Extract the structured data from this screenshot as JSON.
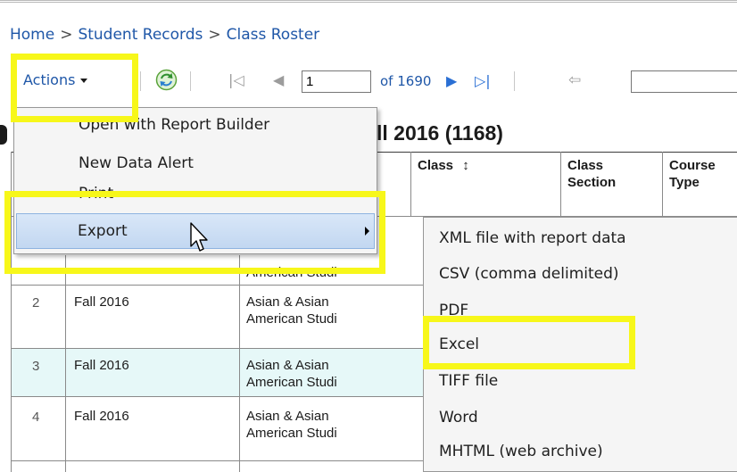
{
  "breadcrumb": {
    "items": [
      "Home",
      "Student Records",
      "Class Roster"
    ],
    "separator": ">"
  },
  "toolbar": {
    "actions_label": "Actions",
    "page_value": "1",
    "page_of": "of 1690"
  },
  "report": {
    "title_visible": "ll 2016 (1168)"
  },
  "table": {
    "headers": {
      "class": "Class",
      "class_sort_glyph": "↕",
      "class_section_1": "Class",
      "class_section_2": "Section",
      "course_type_1": "Course",
      "course_type_2": "Type"
    },
    "row1_partial": "American Studi",
    "rows": [
      {
        "num": "2",
        "term": "Fall 2016",
        "dept_1": "Asian & Asian",
        "dept_2": "American Studi"
      },
      {
        "num": "3",
        "term": "Fall 2016",
        "dept_1": "Asian & Asian",
        "dept_2": "American Studi"
      },
      {
        "num": "4",
        "term": "Fall 2016",
        "dept_1": "Asian & Asian",
        "dept_2": "American Studi"
      }
    ]
  },
  "actions_menu": {
    "items": [
      "Open with Report Builder",
      "New Data Alert",
      "Print",
      "Export"
    ]
  },
  "export_menu": {
    "items": [
      "XML file with report data",
      "CSV (comma delimited)",
      "PDF",
      "Excel",
      "TIFF file",
      "Word",
      "MHTML (web archive)"
    ]
  },
  "colors": {
    "link_blue": "#1f57a8",
    "highlight_yellow": "#f7f71a",
    "selected_row": "#e6f8f8",
    "menu_bg": "#f5f5f5",
    "export_hover": "#c9dcf3"
  },
  "icons": {
    "refresh": "refresh-icon",
    "first_page": "first-page-icon",
    "prev_page": "previous-page-icon",
    "next_page": "next-page-icon",
    "last_page": "last-page-icon",
    "back": "back-icon",
    "cursor": "mouse-pointer-icon"
  }
}
